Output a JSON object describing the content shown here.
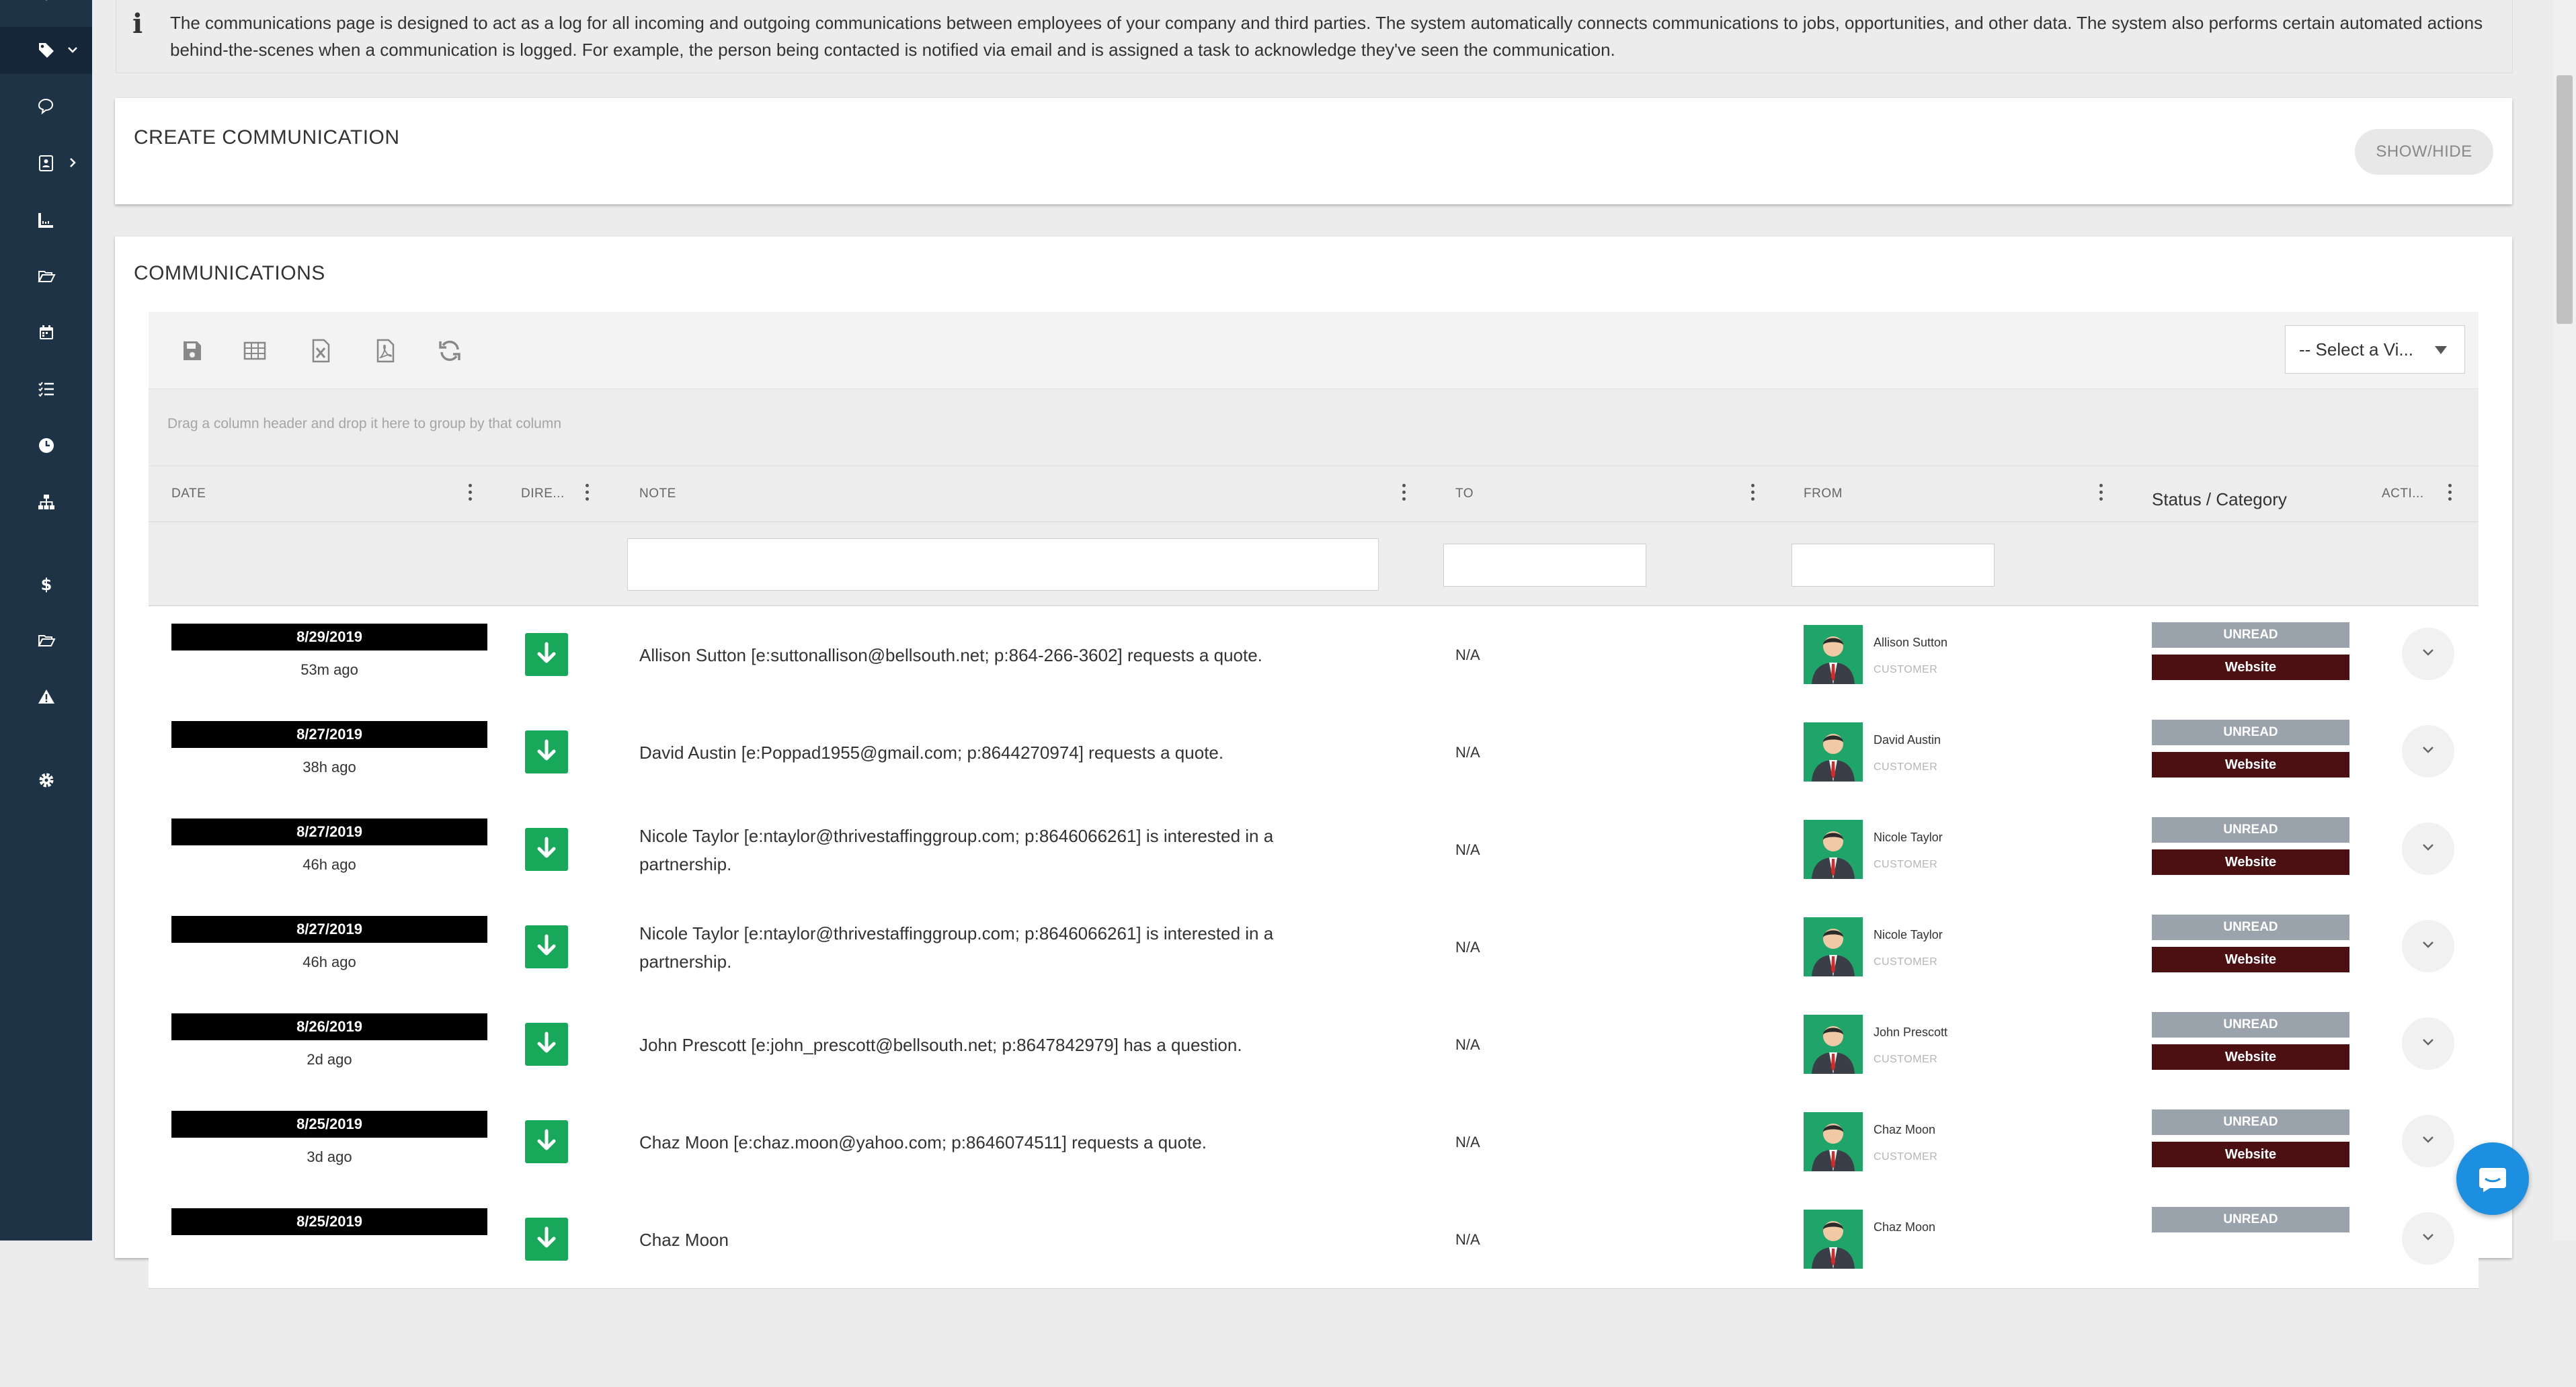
{
  "sidebar": {
    "items": [
      {
        "icon": "tag-icon",
        "active": true
      },
      {
        "icon": "chat-icon"
      },
      {
        "icon": "contact-card-icon"
      },
      {
        "icon": "ruler-icon"
      },
      {
        "icon": "folder-open-icon"
      },
      {
        "icon": "calendar-icon"
      },
      {
        "icon": "task-list-icon"
      },
      {
        "icon": "clock-icon"
      },
      {
        "icon": "org-chart-icon"
      },
      {
        "icon": "dollar-icon"
      },
      {
        "icon": "folder-icon"
      },
      {
        "icon": "warning-icon"
      },
      {
        "icon": "gear-icon"
      }
    ]
  },
  "info": {
    "text": "The communications page is designed to act as a log for all incoming and outgoing communications between employees of your company and third parties. The system automatically connects communications to jobs, opportunities, and other data. The system also performs certain automated actions behind-the-scenes when a communication is logged. For example, the person being contacted is notified via email and is assigned a task to acknowledge they've seen the communication."
  },
  "create_panel": {
    "title": "CREATE COMMUNICATION",
    "toggle_label": "SHOW/HIDE"
  },
  "communications_panel": {
    "title": "COMMUNICATIONS",
    "toolbar": {
      "tools": [
        "save-icon",
        "table-icon",
        "excel-export-icon",
        "pdf-export-icon",
        "refresh-icon"
      ],
      "view_select": "-- Select a Vi..."
    },
    "group_hint": "Drag a column header and drop it here to group by that column",
    "columns": {
      "date": "DATE",
      "direction": "DIRE...",
      "note": "NOTE",
      "to": "TO",
      "from": "FROM",
      "status": "Status / Category",
      "actions": "ACTI..."
    },
    "rows": [
      {
        "date": "8/29/2019",
        "ago": "53m ago",
        "note": "Allison Sutton [e:suttonallison@bellsouth.net; p:864-266-3602] requests a quote.",
        "to": "N/A",
        "from_name": "Allison Sutton",
        "from_role": "CUSTOMER",
        "status": "UNREAD",
        "category": "Website"
      },
      {
        "date": "8/27/2019",
        "ago": "38h ago",
        "note": "David Austin [e:Poppad1955@gmail.com; p:8644270974] requests a quote.",
        "to": "N/A",
        "from_name": "David Austin",
        "from_role": "CUSTOMER",
        "status": "UNREAD",
        "category": "Website"
      },
      {
        "date": "8/27/2019",
        "ago": "46h ago",
        "note": "Nicole Taylor [e:ntaylor@thrivestaffinggroup.com; p:8646066261] is interested in a partnership.",
        "to": "N/A",
        "from_name": "Nicole Taylor",
        "from_role": "CUSTOMER",
        "status": "UNREAD",
        "category": "Website"
      },
      {
        "date": "8/27/2019",
        "ago": "46h ago",
        "note": "Nicole Taylor [e:ntaylor@thrivestaffinggroup.com; p:8646066261] is interested in a partnership.",
        "to": "N/A",
        "from_name": "Nicole Taylor",
        "from_role": "CUSTOMER",
        "status": "UNREAD",
        "category": "Website"
      },
      {
        "date": "8/26/2019",
        "ago": "2d ago",
        "note": "John Prescott [e:john_prescott@bellsouth.net; p:8647842979] has a question.",
        "to": "N/A",
        "from_name": "John Prescott",
        "from_role": "CUSTOMER",
        "status": "UNREAD",
        "category": "Website"
      },
      {
        "date": "8/25/2019",
        "ago": "3d ago",
        "note": "Chaz Moon [e:chaz.moon@yahoo.com; p:8646074511] requests a quote.",
        "to": "N/A",
        "from_name": "Chaz Moon",
        "from_role": "CUSTOMER",
        "status": "UNREAD",
        "category": "Website"
      },
      {
        "date": "8/25/2019",
        "ago": "",
        "note": "Chaz Moon",
        "to": "N/A",
        "from_name": "Chaz Moon",
        "from_role": "",
        "status": "UNREAD",
        "category": ""
      }
    ]
  },
  "colors": {
    "sidebar": "#1f3347",
    "direction_in": "#17a85a",
    "status_unread": "#9aa3ab",
    "category_website": "#4c0f12",
    "chat_button": "#1d8fe1"
  }
}
